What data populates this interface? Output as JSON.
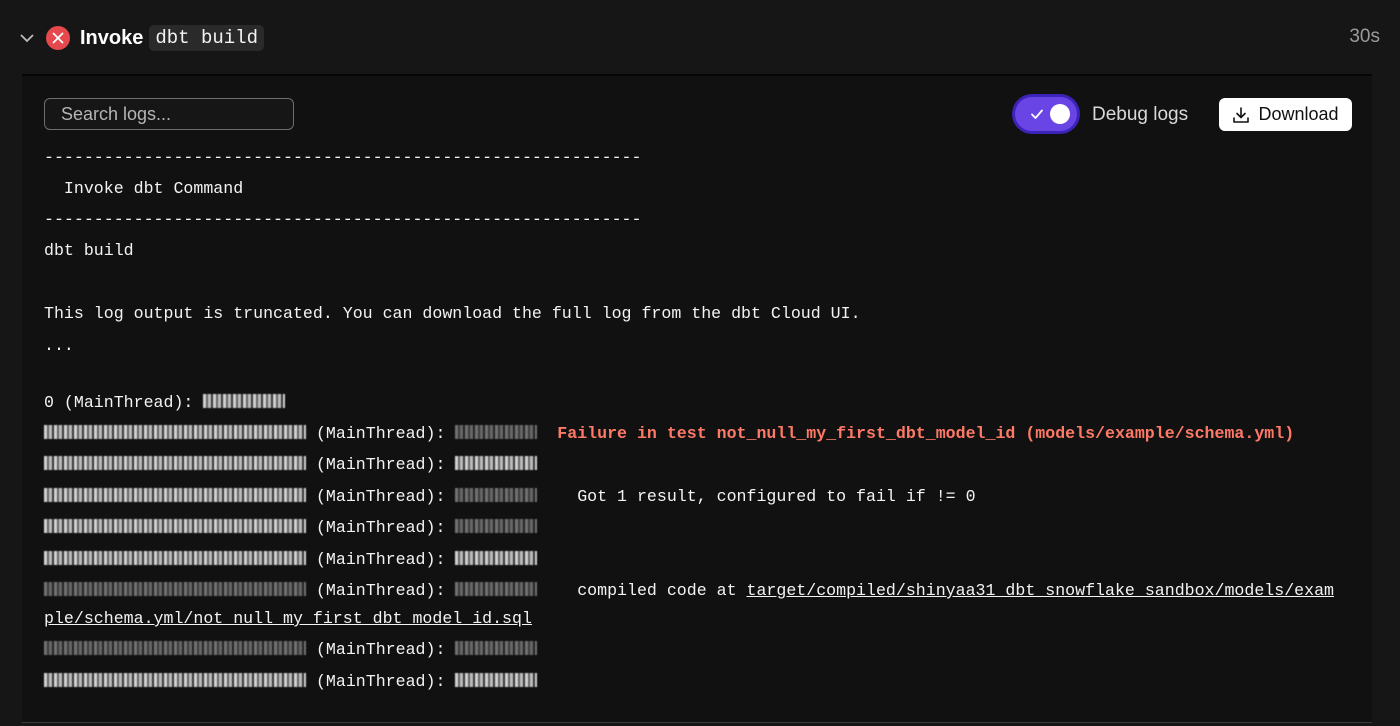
{
  "header": {
    "step_prefix": "Invoke",
    "step_command": "dbt build",
    "duration": "30s"
  },
  "toolbar": {
    "search_placeholder": "Search logs...",
    "debug_logs_label": "Debug logs",
    "debug_logs_enabled": true,
    "download_label": "Download"
  },
  "log": {
    "separator_1": "------------------------------------------------------------",
    "banner": "  Invoke dbt Command",
    "separator_2": "------------------------------------------------------------",
    "command": "dbt build",
    "truncated_notice": "This log output is truncated. You can download the full log from the dbt Cloud UI.",
    "ellipsis": "...",
    "line_0_prefix": "0 (MainThread): ",
    "thread_tag": " (MainThread): ",
    "failure_message": "Failure in test not_null_my_first_dbt_model_id (models/example/schema.yml)",
    "result_message": "  Got 1 result, configured to fail if != 0",
    "compiled_prefix": "  compiled code at ",
    "compiled_path_part1": "target/compiled/shinyaa31_dbt_snowflake_sandbox/models/exam",
    "compiled_path_part2": "ple/schema.yml/not_null_my_first_dbt_model_id.sql"
  },
  "icons": {
    "chevron": "chevron-down-icon",
    "status": "error-x-icon",
    "toggle_check": "check-icon",
    "download": "download-icon"
  },
  "colors": {
    "error": "#e5484d",
    "failure_text": "#ff7a66",
    "toggle_accent": "#6a45e6"
  }
}
